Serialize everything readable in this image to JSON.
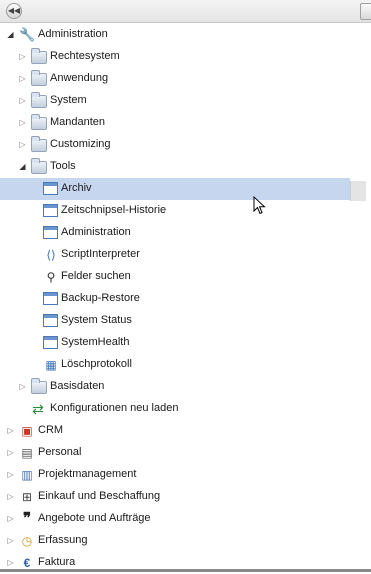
{
  "tree": {
    "nodes": [
      {
        "label": "Administration",
        "icon": "wrench-icon",
        "toggle": "open"
      },
      {
        "label": "Rechtesystem",
        "icon": "lock-folder-icon",
        "toggle": "closed"
      },
      {
        "label": "Anwendung",
        "icon": "folder-icon",
        "toggle": "closed"
      },
      {
        "label": "System",
        "icon": "folder-icon",
        "toggle": "closed"
      },
      {
        "label": "Mandanten",
        "icon": "folder-icon",
        "toggle": "closed"
      },
      {
        "label": "Customizing",
        "icon": "folder-icon",
        "toggle": "closed"
      },
      {
        "label": "Tools",
        "icon": "folder-icon",
        "toggle": "open"
      },
      {
        "label": "Archiv",
        "icon": "archive-icon",
        "toggle": "none",
        "selected": true
      },
      {
        "label": "Zeitschnipsel-Historie",
        "icon": "window-icon",
        "toggle": "none"
      },
      {
        "label": "Administration",
        "icon": "window-icon",
        "toggle": "none"
      },
      {
        "label": "ScriptInterpreter",
        "icon": "script-icon",
        "toggle": "none"
      },
      {
        "label": "Felder suchen",
        "icon": "binoculars-icon",
        "toggle": "none"
      },
      {
        "label": "Backup-Restore",
        "icon": "backup-icon",
        "toggle": "none"
      },
      {
        "label": "System Status",
        "icon": "status-icon",
        "toggle": "none"
      },
      {
        "label": "SystemHealth",
        "icon": "window-icon",
        "toggle": "none"
      },
      {
        "label": "Löschprotokoll",
        "icon": "grid-icon",
        "toggle": "none"
      },
      {
        "label": "Basisdaten",
        "icon": "gear-folder-icon",
        "toggle": "closed"
      },
      {
        "label": "Konfigurationen neu laden",
        "icon": "refresh-icon",
        "toggle": "none"
      },
      {
        "label": "CRM",
        "icon": "crm-icon",
        "toggle": "closed"
      },
      {
        "label": "Personal",
        "icon": "person-icon",
        "toggle": "closed"
      },
      {
        "label": "Projektmanagement",
        "icon": "document-icon",
        "toggle": "closed"
      },
      {
        "label": "Einkauf und Beschaffung",
        "icon": "cart-icon",
        "toggle": "closed"
      },
      {
        "label": "Angebote und Aufträge",
        "icon": "quote-icon",
        "toggle": "closed"
      },
      {
        "label": "Erfassung",
        "icon": "clock-icon",
        "toggle": "closed"
      },
      {
        "label": "Faktura",
        "icon": "euro-icon",
        "toggle": "closed"
      }
    ]
  },
  "colors": {
    "selection": "#c6d6ee",
    "accent": "#4a78b8"
  }
}
